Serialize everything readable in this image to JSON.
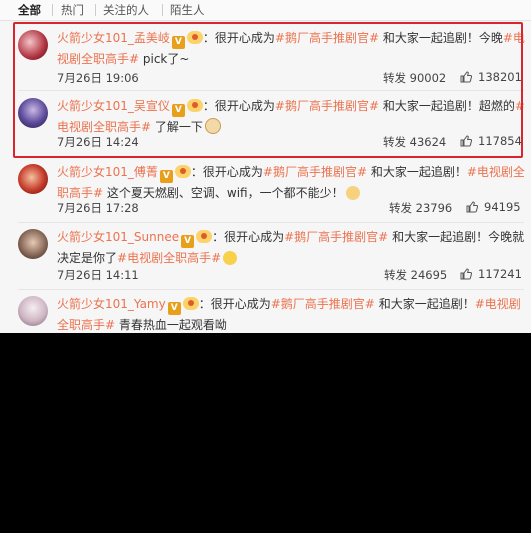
{
  "tabs": [
    "全部",
    "热门",
    "关注的人",
    "陌生人"
  ],
  "comments": [
    {
      "username": "火箭少女101_孟美岐",
      "text_before": "：很开心成为",
      "tag1": "#鹅厂高手推剧官#",
      "text_mid": " 和大家一起追剧！今晚",
      "tag2": "#电视剧全职高手#",
      "text_after": " pick了~",
      "date": "7月26日 19:06",
      "repost_label": "转发",
      "repost_count": "90002",
      "likes": "138201"
    },
    {
      "username": "火箭少女101_吴宣仪",
      "text_before": "：很开心成为",
      "tag1": "#鹅厂高手推剧官#",
      "text_mid": " 和大家一起追剧！超燃的",
      "tag2": "#电视剧全职高手#",
      "text_after": " 了解一下",
      "date": "7月26日 14:24",
      "repost_label": "转发",
      "repost_count": "43624",
      "likes": "117854"
    },
    {
      "username": "火箭少女101_傅菁",
      "text_before": "：很开心成为",
      "tag1": "#鹅厂高手推剧官#",
      "text_mid": " 和大家一起追剧！",
      "tag2": "#电视剧全职高手#",
      "text_after": " 这个夏天燃剧、空调、wifi，一个都不能少！",
      "date": "7月26日 17:28",
      "repost_label": "转发",
      "repost_count": "23796",
      "likes": "94195"
    },
    {
      "username": "火箭少女101_Sunnee",
      "text_before": "：很开心成为",
      "tag1": "#鹅厂高手推剧官#",
      "text_mid": " 和大家一起追剧！今晚就决定是你了",
      "tag2": "#电视剧全职高手#",
      "text_after": "",
      "date": "7月26日 14:11",
      "repost_label": "转发",
      "repost_count": "24695",
      "likes": "117241"
    },
    {
      "username": "火箭少女101_Yamy",
      "text_before": "：很开心成为",
      "tag1": "#鹅厂高手推剧官#",
      "text_mid": " 和大家一起追剧！",
      "tag2": "#电视剧全职高手#",
      "text_after": " 青春热血一起观看呦",
      "date": "",
      "repost_label": "",
      "repost_count": "",
      "likes": ""
    }
  ],
  "colors": {
    "link": "#eb7350",
    "highlight": "#d9262e",
    "text": "#333333"
  }
}
